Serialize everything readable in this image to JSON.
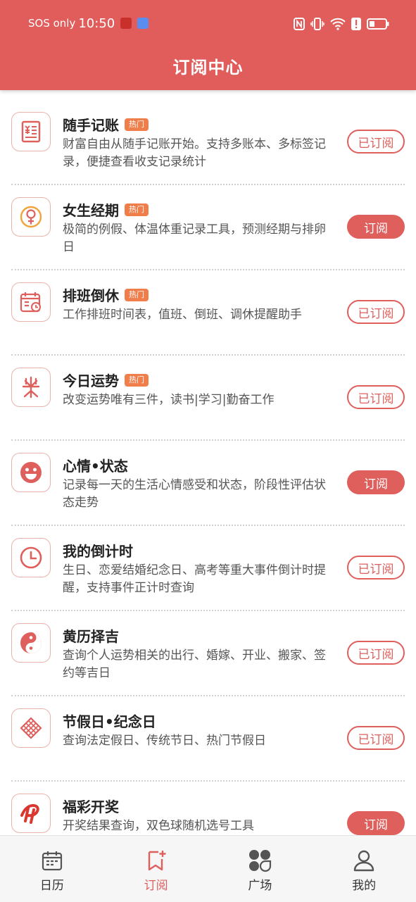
{
  "status_bar": {
    "carrier": "SOS only",
    "time": "10:50"
  },
  "header": {
    "title": "订阅中心"
  },
  "hot_label": "热门",
  "items": [
    {
      "name": "随手记账",
      "hot": true,
      "desc": "财富自由从随手记账开始。支持多账本、多标签记录，便捷查看收支记录统计",
      "button": "已订阅",
      "subscribed": true,
      "icon": "ledger-icon"
    },
    {
      "name": "女生经期",
      "hot": true,
      "desc": "极简的例假、体温体重记录工具，预测经期与排卵日",
      "button": "订阅",
      "subscribed": false,
      "icon": "female-icon"
    },
    {
      "name": "排班倒休",
      "hot": true,
      "desc": "工作排班时间表，值班、倒班、调休提醒助手",
      "button": "已订阅",
      "subscribed": true,
      "icon": "schedule-icon"
    },
    {
      "name": "今日运势",
      "hot": true,
      "desc": "改变运势唯有三件，读书|学习|勤奋工作",
      "button": "已订阅",
      "subscribed": true,
      "icon": "fortune-icon"
    },
    {
      "name": "心情•状态",
      "hot": false,
      "desc": "记录每一天的生活心情感受和状态，阶段性评估状态走势",
      "button": "订阅",
      "subscribed": false,
      "icon": "smile-icon"
    },
    {
      "name": "我的倒计时",
      "hot": false,
      "desc": "生日、恋爱结婚纪念日、高考等重大事件倒计时提醒，支持事件正计时查询",
      "button": "已订阅",
      "subscribed": true,
      "icon": "clock-icon"
    },
    {
      "name": "黄历择吉",
      "hot": false,
      "desc": "查询个人运势相关的出行、婚嫁、开业、搬家、签约等吉日",
      "button": "已订阅",
      "subscribed": true,
      "icon": "yinyang-icon"
    },
    {
      "name": "节假日•纪念日",
      "hot": false,
      "desc": "查询法定假日、传统节日、热门节假日",
      "button": "已订阅",
      "subscribed": true,
      "icon": "knot-icon"
    },
    {
      "name": "福彩开奖",
      "hot": false,
      "desc": "开奖结果查询，双色球随机选号工具",
      "button": "订阅",
      "subscribed": false,
      "icon": "lottery-icon"
    }
  ],
  "tabs": [
    {
      "label": "日历",
      "icon": "calendar-icon",
      "active": false
    },
    {
      "label": "订阅",
      "icon": "bookmark-add-icon",
      "active": true
    },
    {
      "label": "广场",
      "icon": "grid-icon",
      "active": false
    },
    {
      "label": "我的",
      "icon": "profile-icon",
      "active": false
    }
  ],
  "colors": {
    "accent": "#df5f5c",
    "header_bg": "#e05d5b",
    "hot_badge": "#ef7e4b"
  }
}
